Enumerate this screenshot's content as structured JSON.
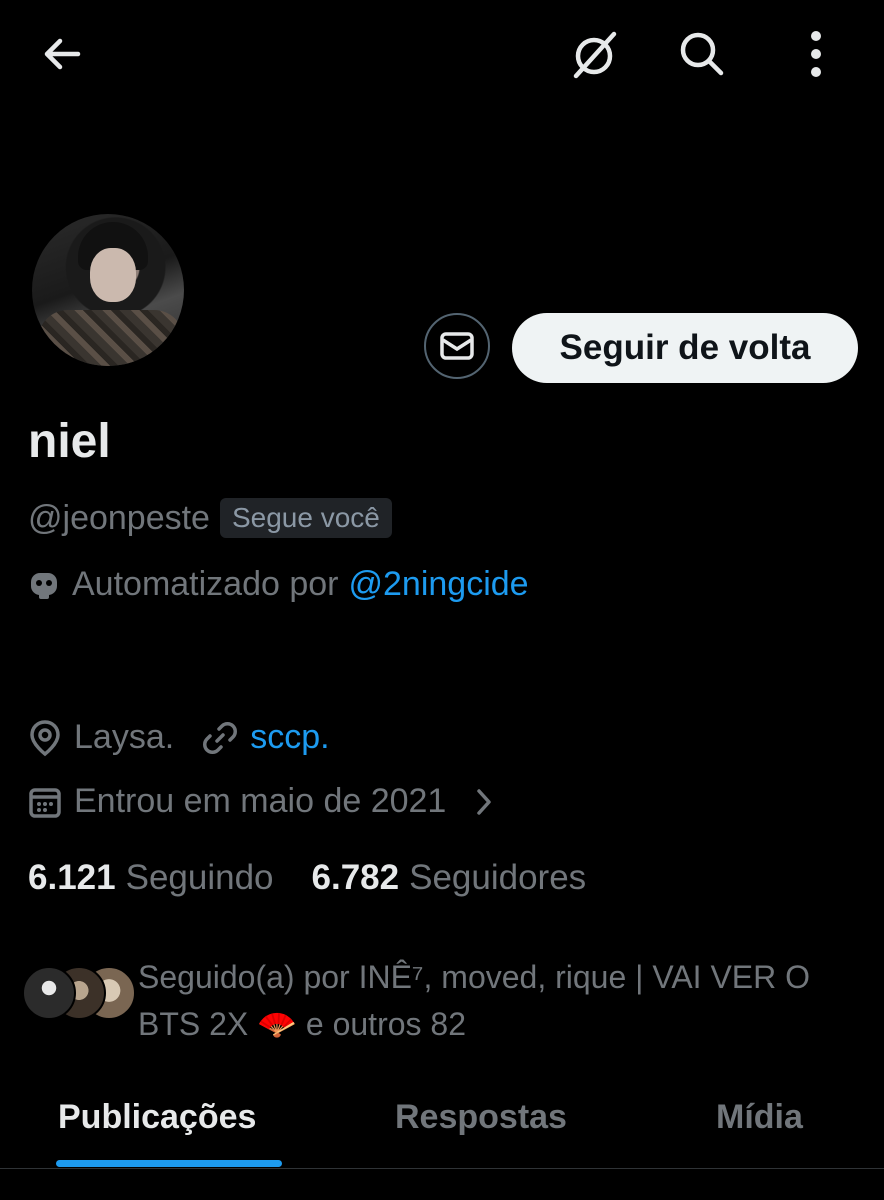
{
  "topbar": {
    "back_icon": "arrow-left-icon",
    "no_data_icon": "data-saver-icon",
    "search_icon": "search-icon",
    "more_icon": "more-vertical-icon"
  },
  "profile": {
    "display_name": "niel",
    "handle": "@jeonpeste",
    "follows_you": "Segue você",
    "automated_prefix": "Automatizado por",
    "automated_by": "@2ningcide",
    "location": "Laysa.",
    "website": "sccp.",
    "joined": "Entrou em maio de 2021"
  },
  "actions": {
    "follow_back_label": "Seguir de volta",
    "message_icon": "mail-icon"
  },
  "stats": {
    "following_count": "6.121",
    "following_label": "Seguindo",
    "followers_count": "6.782",
    "followers_label": "Seguidores"
  },
  "followed_by": {
    "text": "Seguido(a) por INÊ⁷, moved, rique | VAI VER O BTS 2X 🪭 e outros 82"
  },
  "tabs": [
    {
      "label": "Publicações",
      "active": true
    },
    {
      "label": "Respostas",
      "active": false
    },
    {
      "label": "Mídia",
      "active": false
    }
  ],
  "colors": {
    "background": "#000000",
    "accent": "#1d9bf0",
    "muted": "#71767b",
    "text": "#e7e9ea"
  }
}
